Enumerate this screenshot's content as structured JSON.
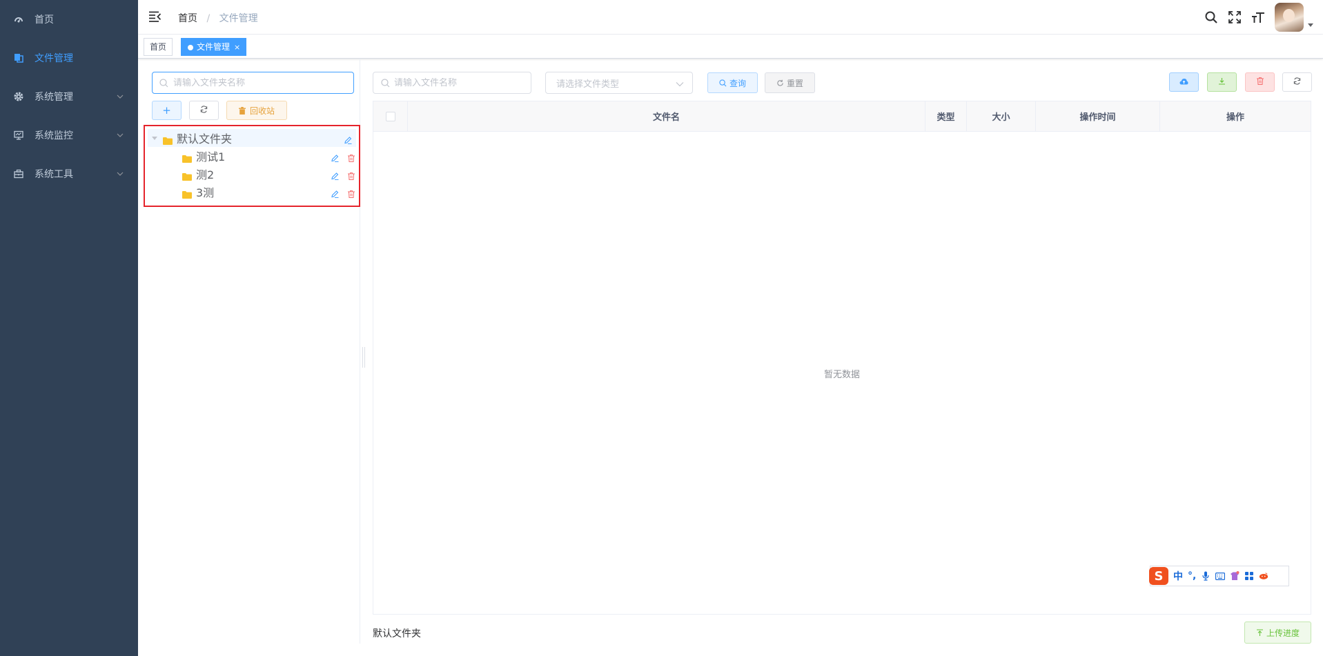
{
  "sidebar": {
    "items": [
      {
        "label": "首页",
        "icon": "dashboard-icon"
      },
      {
        "label": "文件管理",
        "icon": "file-icon",
        "active": true
      },
      {
        "label": "系统管理",
        "icon": "gear-icon"
      },
      {
        "label": "系统监控",
        "icon": "monitor-icon"
      },
      {
        "label": "系统工具",
        "icon": "toolbox-icon"
      }
    ],
    "colors": {
      "bg": "#304156",
      "text": "#bfcbd9",
      "active": "#409eff"
    }
  },
  "navbar": {
    "breadcrumb": {
      "home": "首页",
      "separator": "/",
      "current": "文件管理"
    },
    "icons": [
      "menu-fold-icon",
      "search-icon",
      "fullscreen-icon",
      "font-size-icon"
    ]
  },
  "tags": [
    {
      "label": "首页"
    },
    {
      "label": "文件管理",
      "active": true,
      "close": "×"
    }
  ],
  "folder_panel": {
    "search_placeholder": "请输入文件夹名称",
    "add_label": "+",
    "recycle_label": "回收站",
    "tree": {
      "root": "默认文件夹",
      "children": [
        "测试1",
        "测2",
        "3测"
      ]
    }
  },
  "file_panel": {
    "search_placeholder": "请输入文件名称",
    "type_placeholder": "请选择文件类型",
    "query_label": "查询",
    "reset_label": "重置",
    "columns": [
      "文件名",
      "类型",
      "大小",
      "操作时间",
      "操作"
    ],
    "empty_text": "暂无数据",
    "current_folder": "默认文件夹",
    "progress_label": "上传进度"
  },
  "ime": {
    "logo": "S",
    "mode": "中",
    "punct": "°,"
  },
  "colors": {
    "primary": "#409eff",
    "danger": "#f56c6c",
    "warning": "#e6a23c",
    "success": "#67c23a",
    "folder": "#f8c22a",
    "highlight": "#e5232b"
  }
}
